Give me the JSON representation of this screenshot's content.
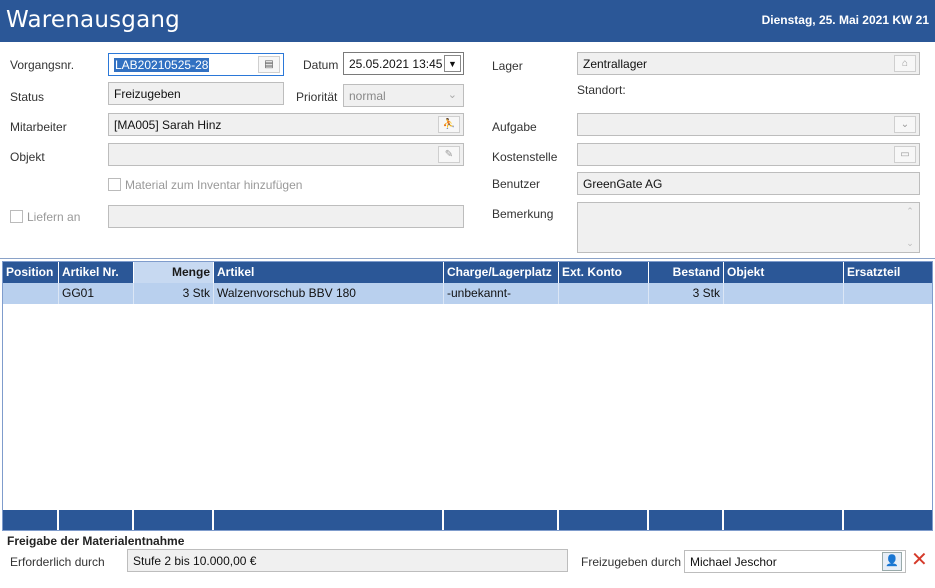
{
  "header": {
    "title": "Warenausgang",
    "date": "Dienstag, 25. Mai 2021  KW 21"
  },
  "form": {
    "vorgangsnr": {
      "label": "Vorgangsnr.",
      "value": "LAB20210525-28"
    },
    "datum": {
      "label": "Datum",
      "value": "25.05.2021 13:45"
    },
    "lager": {
      "label": "Lager",
      "value": "Zentrallager"
    },
    "standort": {
      "label": "Standort:"
    },
    "status": {
      "label": "Status",
      "value": "Freizugeben"
    },
    "prioritaet": {
      "label": "Priorität",
      "value": "normal"
    },
    "mitarbeiter": {
      "label": "Mitarbeiter",
      "value": "[MA005] Sarah Hinz"
    },
    "aufgabe": {
      "label": "Aufgabe",
      "value": ""
    },
    "objekt": {
      "label": "Objekt",
      "value": ""
    },
    "kostenstelle": {
      "label": "Kostenstelle",
      "value": ""
    },
    "material_inventar": {
      "label": "Material zum Inventar hinzufügen",
      "checked": false
    },
    "benutzer": {
      "label": "Benutzer",
      "value": "GreenGate AG"
    },
    "liefern_an": {
      "label": "Liefern an",
      "checked": false,
      "value": ""
    },
    "bemerkung": {
      "label": "Bemerkung",
      "value": ""
    }
  },
  "grid": {
    "columns": [
      "Position",
      "Artikel Nr.",
      "Menge",
      "Artikel",
      "Charge/Lagerplatz",
      "Ext. Konto",
      "Bestand",
      "Objekt",
      "Ersatzteil"
    ],
    "rows": [
      {
        "position": "",
        "artikel_nr": "GG01",
        "menge": "3 Stk",
        "artikel": "Walzenvorschub BBV 180",
        "charge": "-unbekannt-",
        "ext_konto": "",
        "bestand": "3 Stk",
        "objekt": "",
        "ersatzteil": ""
      }
    ]
  },
  "freigabe": {
    "title": "Freigabe der Materialentnahme",
    "erforderlich_label": "Erforderlich durch",
    "erforderlich_value": "Stufe 2 bis 10.000,00 €",
    "freizugeben_label": "Freizugeben durch",
    "freizugeben_value": "Michael Jeschor"
  },
  "colors": {
    "brand": "#2b5797",
    "row_selected": "#b9d0ee",
    "clear": "#d53a2a"
  },
  "icons": [
    "barcode-icon",
    "dropdown-arrow-icon",
    "chevron-down-icon",
    "warehouse-icon",
    "person-icon",
    "object-icon",
    "cost-center-icon",
    "user-select-icon",
    "clear-icon"
  ]
}
